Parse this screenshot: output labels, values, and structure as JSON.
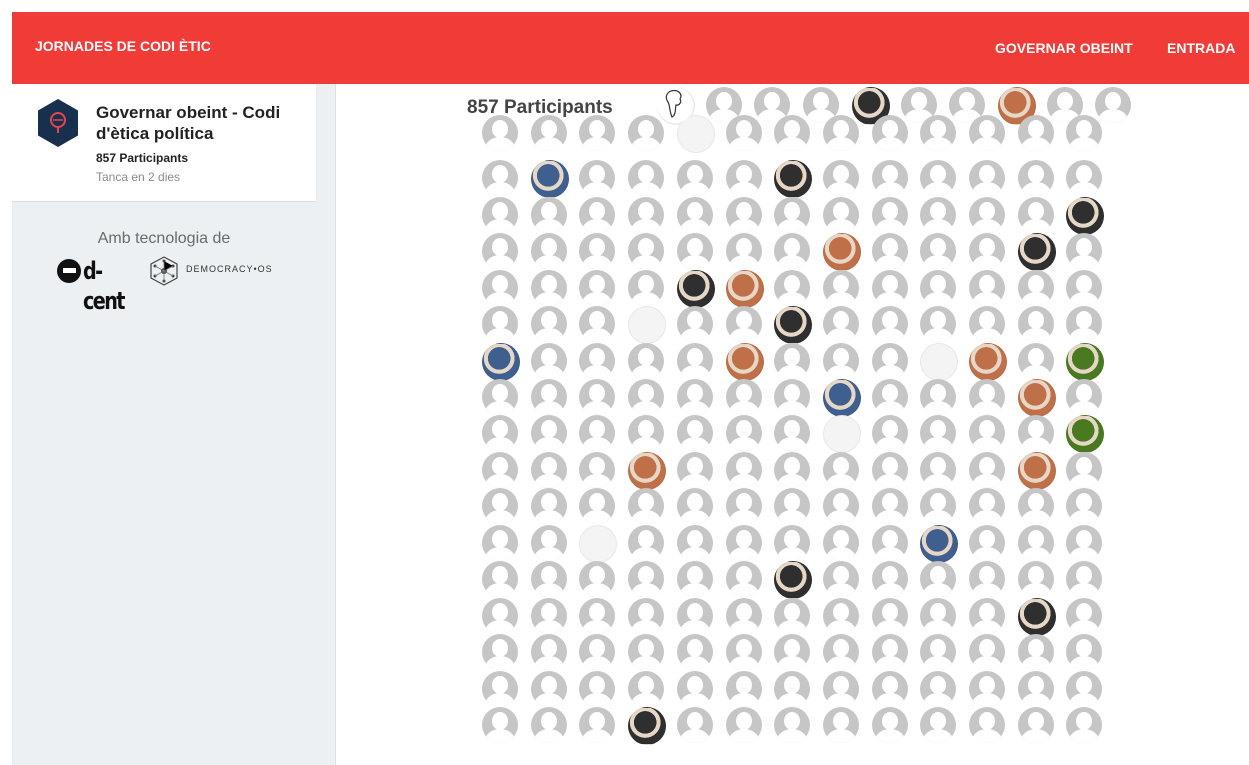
{
  "header": {
    "brand": "JORNADES DE CODI ÈTIC",
    "nav": [
      "GOVERNAR OBEINT",
      "ENTRADA"
    ],
    "background_color": "#f13b37"
  },
  "sidebar": {
    "topic": {
      "title": "Governar obeint - Codi d'ètica política",
      "participants": "857 Participants",
      "closing": "Tanca en 2 dies",
      "icon": "law-hexagon-icon"
    },
    "powered_by": "Amb tecnologia de",
    "logos": [
      {
        "name": "dcent-logo",
        "text": "d-cent"
      },
      {
        "name": "democracyos-logo",
        "text": "DEMOCRACY•OS"
      }
    ]
  },
  "main": {
    "participants_title": "857 Participants",
    "avatar_colors": {
      "default": "#c6c6c6",
      "photo_dark": "#2f2f2f",
      "photo_warm": "#c07048",
      "photo_blue": "#3f5f8f",
      "photo_green": "#4a7a20"
    }
  }
}
